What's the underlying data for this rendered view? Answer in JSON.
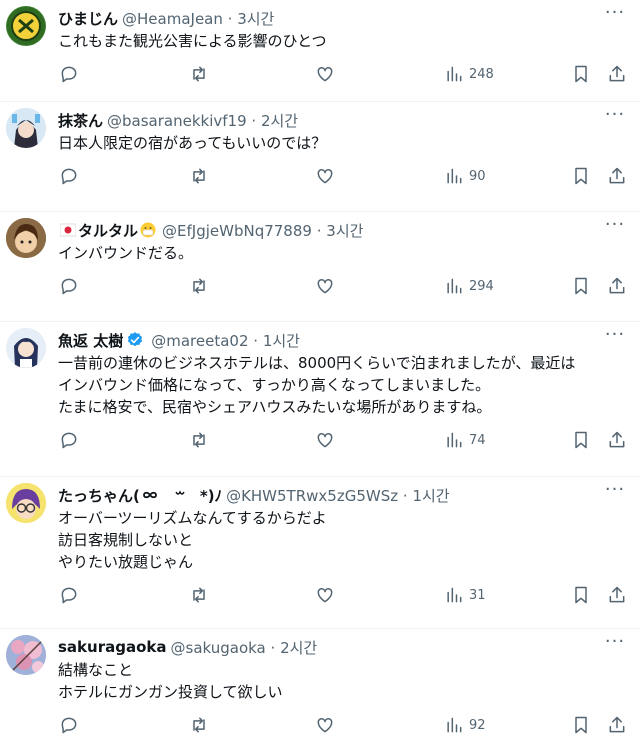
{
  "tweets": [
    {
      "name": "ひまじん",
      "handle": "@HeamaJean",
      "time": "3시간",
      "lines": [
        "これもまた観光公害による影響のひとつ"
      ],
      "views": "248"
    },
    {
      "name": "抹茶ん",
      "handle": "@basaranekkivf19",
      "time": "2시간",
      "lines": [
        "日本人限定の宿があってもいいのでは？"
      ],
      "views": "90"
    },
    {
      "name": "タルタル",
      "handle": "@EfJgjeWbNq77889",
      "time": "3시간",
      "lines": [
        "インバウンドだる。"
      ],
      "views": "294"
    },
    {
      "name": "魚返 太樹",
      "handle": "@mareeta02",
      "time": "1시간",
      "lines": [
        "一昔前の連休のビジネスホテルは、8000円くらいで泊まれましたが、最近は",
        "インバウンド価格になって、すっかり高くなってしまいました。",
        "たまに格安で、民宿やシェアハウスみたいな場所がありますね。"
      ],
      "views": "74"
    },
    {
      "name": "たっちゃん(",
      "name_suffix": "*)ﾉ",
      "handle": "@KHW5TRwx5zG5WSz",
      "time": "1시간",
      "lines": [
        "オーバーツーリズムなんてするからだよ",
        "訪日客規制しないと",
        "やりたい放題じゃん"
      ],
      "views": "31"
    },
    {
      "name": "sakuragaoka",
      "handle": "@sakugaoka",
      "time": "2시간",
      "lines": [
        "結構なこと",
        "ホテルにガンガン投資して欲しい"
      ],
      "views": "92"
    }
  ],
  "separator": "·",
  "colors": {
    "text": "#0f1419",
    "muted": "#536471",
    "border": "#eff3f4",
    "verified": "#1d9bf0"
  }
}
